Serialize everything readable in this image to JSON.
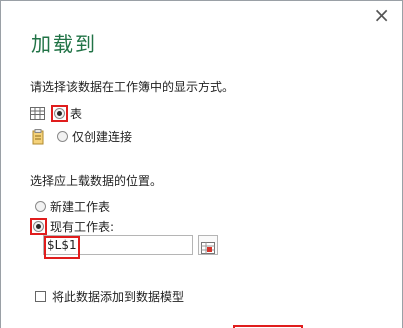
{
  "dialog": {
    "close_glyph": "×",
    "title": "加载到"
  },
  "view_section": {
    "prompt": "请选择该数据在工作簿中的显示方式。",
    "options": [
      {
        "label": "表",
        "selected": true,
        "icon": "table-icon"
      },
      {
        "label": "仅创建连接",
        "selected": false,
        "icon": "connection-icon"
      }
    ]
  },
  "location_section": {
    "prompt": "选择应上载数据的位置。",
    "options": [
      {
        "label": "新建工作表",
        "selected": false
      },
      {
        "label": "现有工作表:",
        "selected": true
      }
    ],
    "cell_value": "$L$1",
    "picker_icon": "range-picker-icon"
  },
  "data_model": {
    "label": "将此数据添加到数据模型",
    "checked": false
  },
  "colors": {
    "title": "#217346",
    "highlight": "#e01d1d"
  }
}
